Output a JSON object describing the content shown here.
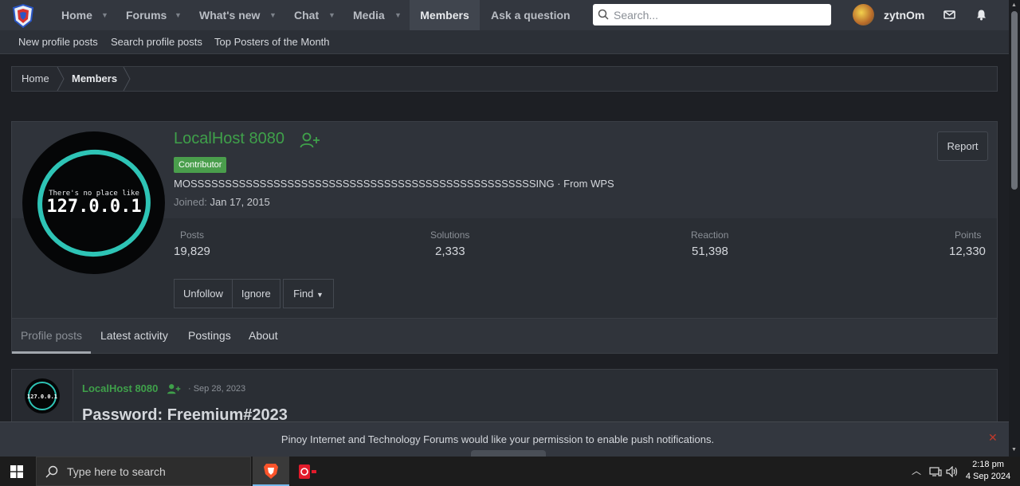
{
  "nav": {
    "items": [
      {
        "label": "Home"
      },
      {
        "label": "Forums"
      },
      {
        "label": "What's new"
      },
      {
        "label": "Chat"
      },
      {
        "label": "Media"
      },
      {
        "label": "Members"
      },
      {
        "label": "Ask a question"
      }
    ],
    "search_placeholder": "Search...",
    "username": "zytnOm"
  },
  "subnav": [
    "New profile posts",
    "Search profile posts",
    "Top Posters of the Month"
  ],
  "breadcrumb": [
    "Home",
    "Members"
  ],
  "profile": {
    "name": "LocalHost 8080",
    "badge": "Contributor",
    "blurb": "MOSSSSSSSSSSSSSSSSSSSSSSSSSSSSSSSSSSSSSSSSSSSSSSSSSSING · From WPS",
    "joined_label": "Joined:",
    "joined_date": "Jan 17, 2015",
    "avatar_line1": "There's no place like",
    "avatar_line2": "127.0.0.1",
    "report_label": "Report",
    "stats": [
      {
        "label": "Posts",
        "value": "19,829"
      },
      {
        "label": "Solutions",
        "value": "2,333"
      },
      {
        "label": "Reaction",
        "value": "51,398"
      },
      {
        "label": "Points",
        "value": "12,330"
      }
    ],
    "actions": [
      "Unfollow",
      "Ignore"
    ],
    "find_label": "Find"
  },
  "tabs": [
    "Profile posts",
    "Latest activity",
    "Postings",
    "About"
  ],
  "post": {
    "author": "LocalHost 8080",
    "date": "· Sep 28, 2023",
    "title": "Password: Freemium#2023",
    "avatar_text": "127.0.0.1"
  },
  "push": {
    "text": "Pinoy Internet and Technology Forums would like your permission to enable push notifications."
  },
  "taskbar": {
    "search_placeholder": "Type here to search",
    "time": "2:18 pm",
    "date": "4 Sep 2024"
  },
  "colors": {
    "accent_green": "#3fa04a",
    "nav_bg": "#33373f",
    "teal_ring": "#2ec4b6"
  }
}
